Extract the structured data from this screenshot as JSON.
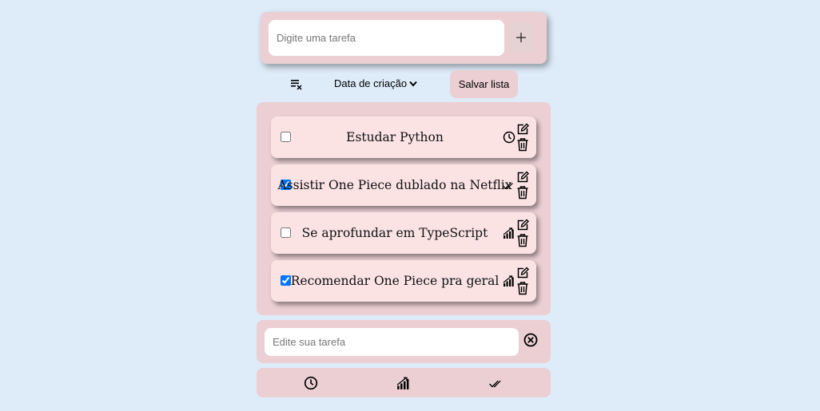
{
  "add_form": {
    "input_placeholder": "Digite uma tarefa",
    "add_button_icon": "plus-icon"
  },
  "toolbar": {
    "clear_icon": "clear-list-icon",
    "sort_label": "Data de criação",
    "save_label": "Salvar lista"
  },
  "tasks": [
    {
      "text": "Estudar Python",
      "checked": false,
      "status_icon": "clock-icon"
    },
    {
      "text": "Assistir One Piece dublado na Netflix",
      "checked": true,
      "status_icon": "double-check-icon"
    },
    {
      "text": "Se aprofundar em TypeScript",
      "checked": false,
      "status_icon": "signal-bars-icon"
    },
    {
      "text": "Recomendar One Piece pra geral",
      "checked": true,
      "status_icon": "signal-bars-icon"
    }
  ],
  "edit_form": {
    "input_placeholder": "Edite sua tarefa",
    "cancel_icon": "close-circle-icon"
  },
  "filters": [
    {
      "icon": "clock-icon"
    },
    {
      "icon": "signal-bars-icon"
    },
    {
      "icon": "double-check-icon"
    }
  ],
  "colors": {
    "background": "#deebf9",
    "panel": "#ebcfd3",
    "task_card": "#fbe3e4",
    "checkbox_accent": "#1a56db"
  }
}
